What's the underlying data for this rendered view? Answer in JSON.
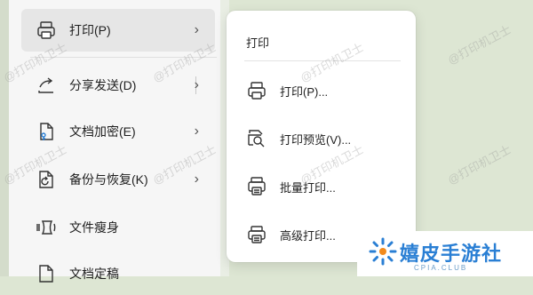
{
  "left_menu": {
    "items": [
      {
        "label": "打印(P)",
        "icon": "printer-icon",
        "has_arrow": true,
        "active": true
      },
      {
        "label": "分享发送(D)",
        "icon": "share-icon",
        "has_arrow": true
      },
      {
        "label": "文档加密(E)",
        "icon": "document-lock-icon",
        "has_arrow": true
      },
      {
        "label": "备份与恢复(K)",
        "icon": "backup-restore-icon",
        "has_arrow": true
      },
      {
        "label": "文件瘦身",
        "icon": "file-compress-icon",
        "has_arrow": false
      },
      {
        "label": "文档定稿",
        "icon": "document-finalize-icon",
        "has_arrow": false
      }
    ],
    "arrow_glyph": "›"
  },
  "submenu": {
    "title": "打印",
    "items": [
      {
        "label": "打印(P)...",
        "icon": "printer-icon"
      },
      {
        "label": "打印预览(V)...",
        "icon": "print-preview-icon"
      },
      {
        "label": "批量打印...",
        "icon": "batch-print-icon"
      },
      {
        "label": "高级打印...",
        "icon": "advanced-print-icon"
      }
    ]
  },
  "watermark": {
    "text": "@打印机卫士"
  },
  "logo": {
    "name": "嬉皮手游社",
    "sub": "CPIA.CLUB"
  },
  "colors": {
    "accent": "#2a7fd4",
    "active_bg": "#e6e6e6",
    "panel_bg": "#ffffff"
  }
}
